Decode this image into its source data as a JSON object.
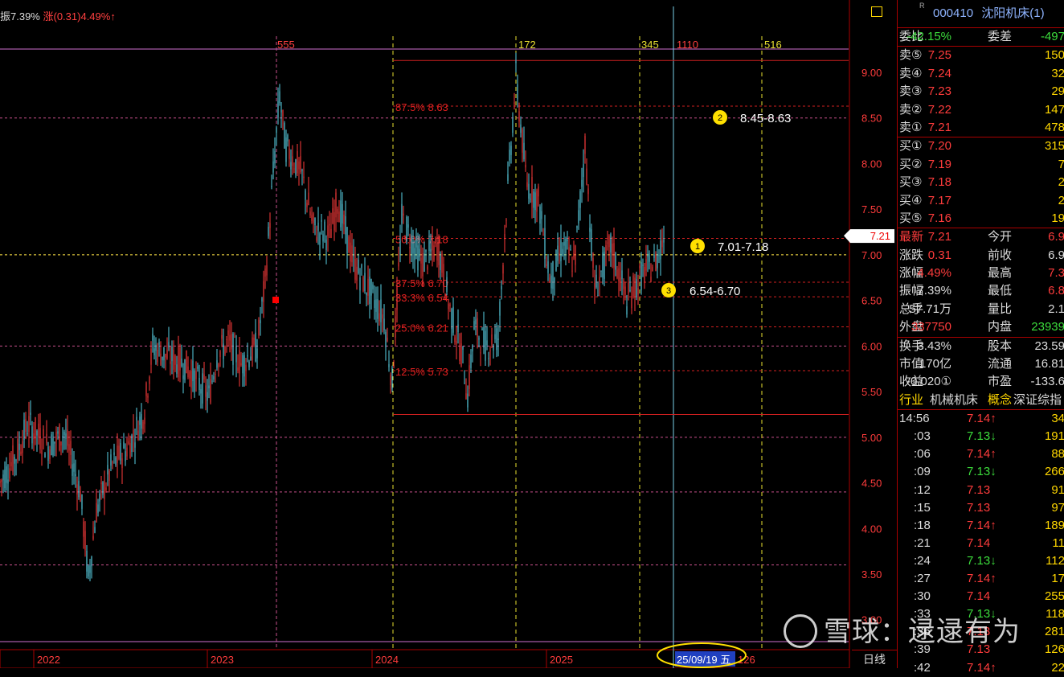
{
  "top_info": {
    "left": "振7.39%",
    "right": "涨(0.31)4.49%↑"
  },
  "stock": {
    "code": "000410",
    "name": "沈阳机床(1)",
    "marker": "R"
  },
  "order_ratio": {
    "label1": "委比",
    "val1": "-42.15%",
    "label2": "委差",
    "val2": "-497"
  },
  "asks": [
    {
      "label": "卖⑤",
      "price": "7.25",
      "vol": "150"
    },
    {
      "label": "卖④",
      "price": "7.24",
      "vol": "32"
    },
    {
      "label": "卖③",
      "price": "7.23",
      "vol": "29"
    },
    {
      "label": "卖②",
      "price": "7.22",
      "vol": "147"
    },
    {
      "label": "卖①",
      "price": "7.21",
      "vol": "478"
    }
  ],
  "bids": [
    {
      "label": "买①",
      "price": "7.20",
      "vol": "315"
    },
    {
      "label": "买②",
      "price": "7.19",
      "vol": "7"
    },
    {
      "label": "买③",
      "price": "7.18",
      "vol": "2"
    },
    {
      "label": "买④",
      "price": "7.17",
      "vol": "2"
    },
    {
      "label": "买⑤",
      "price": "7.16",
      "vol": "19"
    }
  ],
  "quote": [
    {
      "l1": "最新",
      "v1": "7.21",
      "c1": "red",
      "l2": "今开",
      "v2": "6.9",
      "c2": "red"
    },
    {
      "l1": "涨跌",
      "v1": "0.31",
      "c1": "red",
      "l2": "前收",
      "v2": "6.9",
      "c2": "white"
    },
    {
      "l1": "涨幅",
      "v1": "4.49%",
      "c1": "red",
      "l2": "最高",
      "v2": "7.3",
      "c2": "red"
    },
    {
      "l1": "振幅",
      "v1": "7.39%",
      "c1": "white",
      "l2": "最低",
      "v2": "6.8",
      "c2": "red"
    },
    {
      "l1": "总手",
      "v1": "57.71万",
      "c1": "white",
      "l2": "量比",
      "v2": "2.1",
      "c2": "white"
    },
    {
      "l1": "外盘",
      "v1": "337750",
      "c1": "red",
      "l2": "内盘",
      "v2": "23939",
      "c2": "green"
    }
  ],
  "fundamentals": [
    {
      "l1": "换手",
      "v1": "3.43%",
      "l2": "股本",
      "v2": "23.59"
    },
    {
      "l1": "市值",
      "v1": "170亿",
      "l2": "流通",
      "v2": "16.81"
    },
    {
      "l1": "收益",
      "v1": "-0.020①",
      "l2": "市盈",
      "v2": "-133.6"
    }
  ],
  "industry": {
    "label": "行业",
    "value": "机械机床",
    "concept_label": "概念",
    "concept_value": "深证综指"
  },
  "ticks": [
    {
      "time": "14:56",
      "price": "7.14↑",
      "color": "red",
      "vol": "34"
    },
    {
      "time": ":03",
      "price": "7.13↓",
      "color": "green",
      "vol": "191"
    },
    {
      "time": ":06",
      "price": "7.14↑",
      "color": "red",
      "vol": "88"
    },
    {
      "time": ":09",
      "price": "7.13↓",
      "color": "green",
      "vol": "266"
    },
    {
      "time": ":12",
      "price": "7.13",
      "color": "red",
      "vol": "91"
    },
    {
      "time": ":15",
      "price": "7.13",
      "color": "red",
      "vol": "97"
    },
    {
      "time": ":18",
      "price": "7.14↑",
      "color": "red",
      "vol": "189"
    },
    {
      "time": ":21",
      "price": "7.14",
      "color": "red",
      "vol": "11"
    },
    {
      "time": ":24",
      "price": "7.13↓",
      "color": "green",
      "vol": "112"
    },
    {
      "time": ":27",
      "price": "7.14↑",
      "color": "red",
      "vol": "17"
    },
    {
      "time": ":30",
      "price": "7.14",
      "color": "red",
      "vol": "255"
    },
    {
      "time": ":33",
      "price": "7.13↓",
      "color": "green",
      "vol": "118"
    },
    {
      "time": ":36",
      "price": "7.13",
      "color": "red",
      "vol": "281"
    },
    {
      "time": ":39",
      "price": "7.13",
      "color": "red",
      "vol": "126"
    },
    {
      "time": ":42",
      "price": "7.14↑",
      "color": "red",
      "vol": "22"
    }
  ],
  "y_axis": {
    "ticks": [
      "9.00",
      "8.50",
      "8.00",
      "7.50",
      "7.00",
      "6.50",
      "6.00",
      "5.50",
      "5.00",
      "4.50",
      "4.00",
      "3.50",
      "3.00"
    ],
    "current": "7.21"
  },
  "x_axis": {
    "years": [
      "2022",
      "2023",
      "2024",
      "2025"
    ]
  },
  "counts": [
    "555",
    "172",
    "345",
    "1110",
    "516"
  ],
  "fib_levels": [
    {
      "label": "87.5% 8.63",
      "price": 8.63
    },
    {
      "label": "50.0% 7.18",
      "price": 7.18
    },
    {
      "label": "37.5% 6.70",
      "price": 6.7
    },
    {
      "label": "33.3% 6.54",
      "price": 6.54
    },
    {
      "label": "25.0% 6.21",
      "price": 6.21
    },
    {
      "label": "12.5% 5.73",
      "price": 5.73
    }
  ],
  "annotations": [
    {
      "num": "1",
      "text": "7.01-7.18"
    },
    {
      "num": "2",
      "text": "8.45-8.63"
    },
    {
      "num": "3",
      "text": "6.54-6.70"
    }
  ],
  "cursor_date": "25/09/19 五",
  "cursor_extra": "126",
  "period": "日线",
  "watermark": "雪球：逯逯有为",
  "colors": {
    "up": "#ff3c3c",
    "down": "#5ad2e6",
    "grid": "#c8508c",
    "fib": "#e8e030",
    "up_text": "#ff3c3c",
    "down_text": "#3cdc3c"
  },
  "chart_data": {
    "type": "candlestick",
    "ylim": [
      3.0,
      9.3
    ],
    "x_labels": [
      "2022",
      "2023",
      "2024",
      "2025"
    ],
    "last_price": 7.21,
    "fib_range": [
      5.25,
      9.13
    ],
    "fib_marked": [
      8.63,
      7.18,
      6.7,
      6.54,
      6.21,
      5.73
    ],
    "price_path": [
      [
        0,
        4.5
      ],
      [
        20,
        4.8
      ],
      [
        35,
        5.15
      ],
      [
        60,
        4.9
      ],
      [
        80,
        5.05
      ],
      [
        100,
        4.4
      ],
      [
        110,
        3.45
      ],
      [
        120,
        4.2
      ],
      [
        140,
        4.7
      ],
      [
        160,
        4.9
      ],
      [
        180,
        5.3
      ],
      [
        190,
        6.0
      ],
      [
        205,
        5.9
      ],
      [
        230,
        5.8
      ],
      [
        260,
        5.45
      ],
      [
        270,
        5.9
      ],
      [
        285,
        6.05
      ],
      [
        300,
        5.8
      ],
      [
        320,
        6.0
      ],
      [
        330,
        6.7
      ],
      [
        340,
        7.9
      ],
      [
        348,
        8.75
      ],
      [
        355,
        8.2
      ],
      [
        375,
        7.9
      ],
      [
        390,
        7.3
      ],
      [
        410,
        7.2
      ],
      [
        420,
        7.6
      ],
      [
        440,
        6.9
      ],
      [
        460,
        6.6
      ],
      [
        478,
        6.3
      ],
      [
        488,
        5.6
      ],
      [
        500,
        7.4
      ],
      [
        525,
        6.9
      ],
      [
        545,
        7.1
      ],
      [
        560,
        6.4
      ],
      [
        575,
        5.9
      ],
      [
        582,
        5.45
      ],
      [
        590,
        6.2
      ],
      [
        605,
        6.0
      ],
      [
        620,
        6.1
      ],
      [
        630,
        7.5
      ],
      [
        642,
        8.95
      ],
      [
        655,
        7.8
      ],
      [
        670,
        7.6
      ],
      [
        685,
        6.7
      ],
      [
        700,
        7.1
      ],
      [
        715,
        6.9
      ],
      [
        728,
        8.2
      ],
      [
        740,
        6.6
      ],
      [
        760,
        7.1
      ],
      [
        780,
        6.5
      ],
      [
        800,
        6.8
      ],
      [
        815,
        6.9
      ],
      [
        826,
        7.21
      ]
    ]
  }
}
